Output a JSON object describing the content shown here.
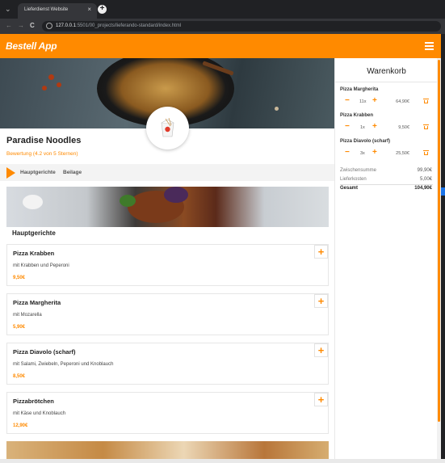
{
  "browser": {
    "tab_title": "Lieferdienst Website",
    "tab_close": "×",
    "new_tab": "+",
    "url_host": "127.0.0.1",
    "url_path": ":5501/00_projects/lieferando-standard/index.html",
    "back": "←",
    "forward": "→",
    "reload": "C",
    "dropdown": "⌄"
  },
  "header": {
    "logo": "Bestell App",
    "menu_icon": "hamburger-icon"
  },
  "restaurant": {
    "name": "Paradise Noodles",
    "rating": "Bewertung (4.2 von 5 Sternen)",
    "categories": [
      "Hauptgerichte",
      "Beilage"
    ]
  },
  "section": {
    "title": "Hauptgerichte"
  },
  "dishes": [
    {
      "name": "Pizza Krabben",
      "desc": "mit Krabben und Peperoni",
      "price": "9,50€"
    },
    {
      "name": "Pizza Margherita",
      "desc": "mit Mozarella",
      "price": "5,90€"
    },
    {
      "name": "Pizza Diavolo (scharf)",
      "desc": "mit Salami, Zwiebeln, Peperoni und Knoblauch",
      "price": "8,50€"
    },
    {
      "name": "Pizzabrötchen",
      "desc": "mit Käse und Knoblauch",
      "price": "12,90€"
    }
  ],
  "dish_add_label": "+",
  "cart": {
    "title": "Warenkorb",
    "minus": "−",
    "plus": "+",
    "items": [
      {
        "name": "Pizza Margherita",
        "qty": "11x",
        "price": "64,90€"
      },
      {
        "name": "Pizza Krabben",
        "qty": "1x",
        "price": "9,50€"
      },
      {
        "name": "Pizza Diavolo (scharf)",
        "qty": "3x",
        "price": "25,50€"
      }
    ],
    "subtotal_label": "Zwischensumme",
    "subtotal_value": "99,90€",
    "delivery_label": "Lieferkosten",
    "delivery_value": "5,00€",
    "total_label": "Gesamt",
    "total_value": "104,90€"
  },
  "colors": {
    "accent": "#ff8a00",
    "chrome": "#202124"
  }
}
